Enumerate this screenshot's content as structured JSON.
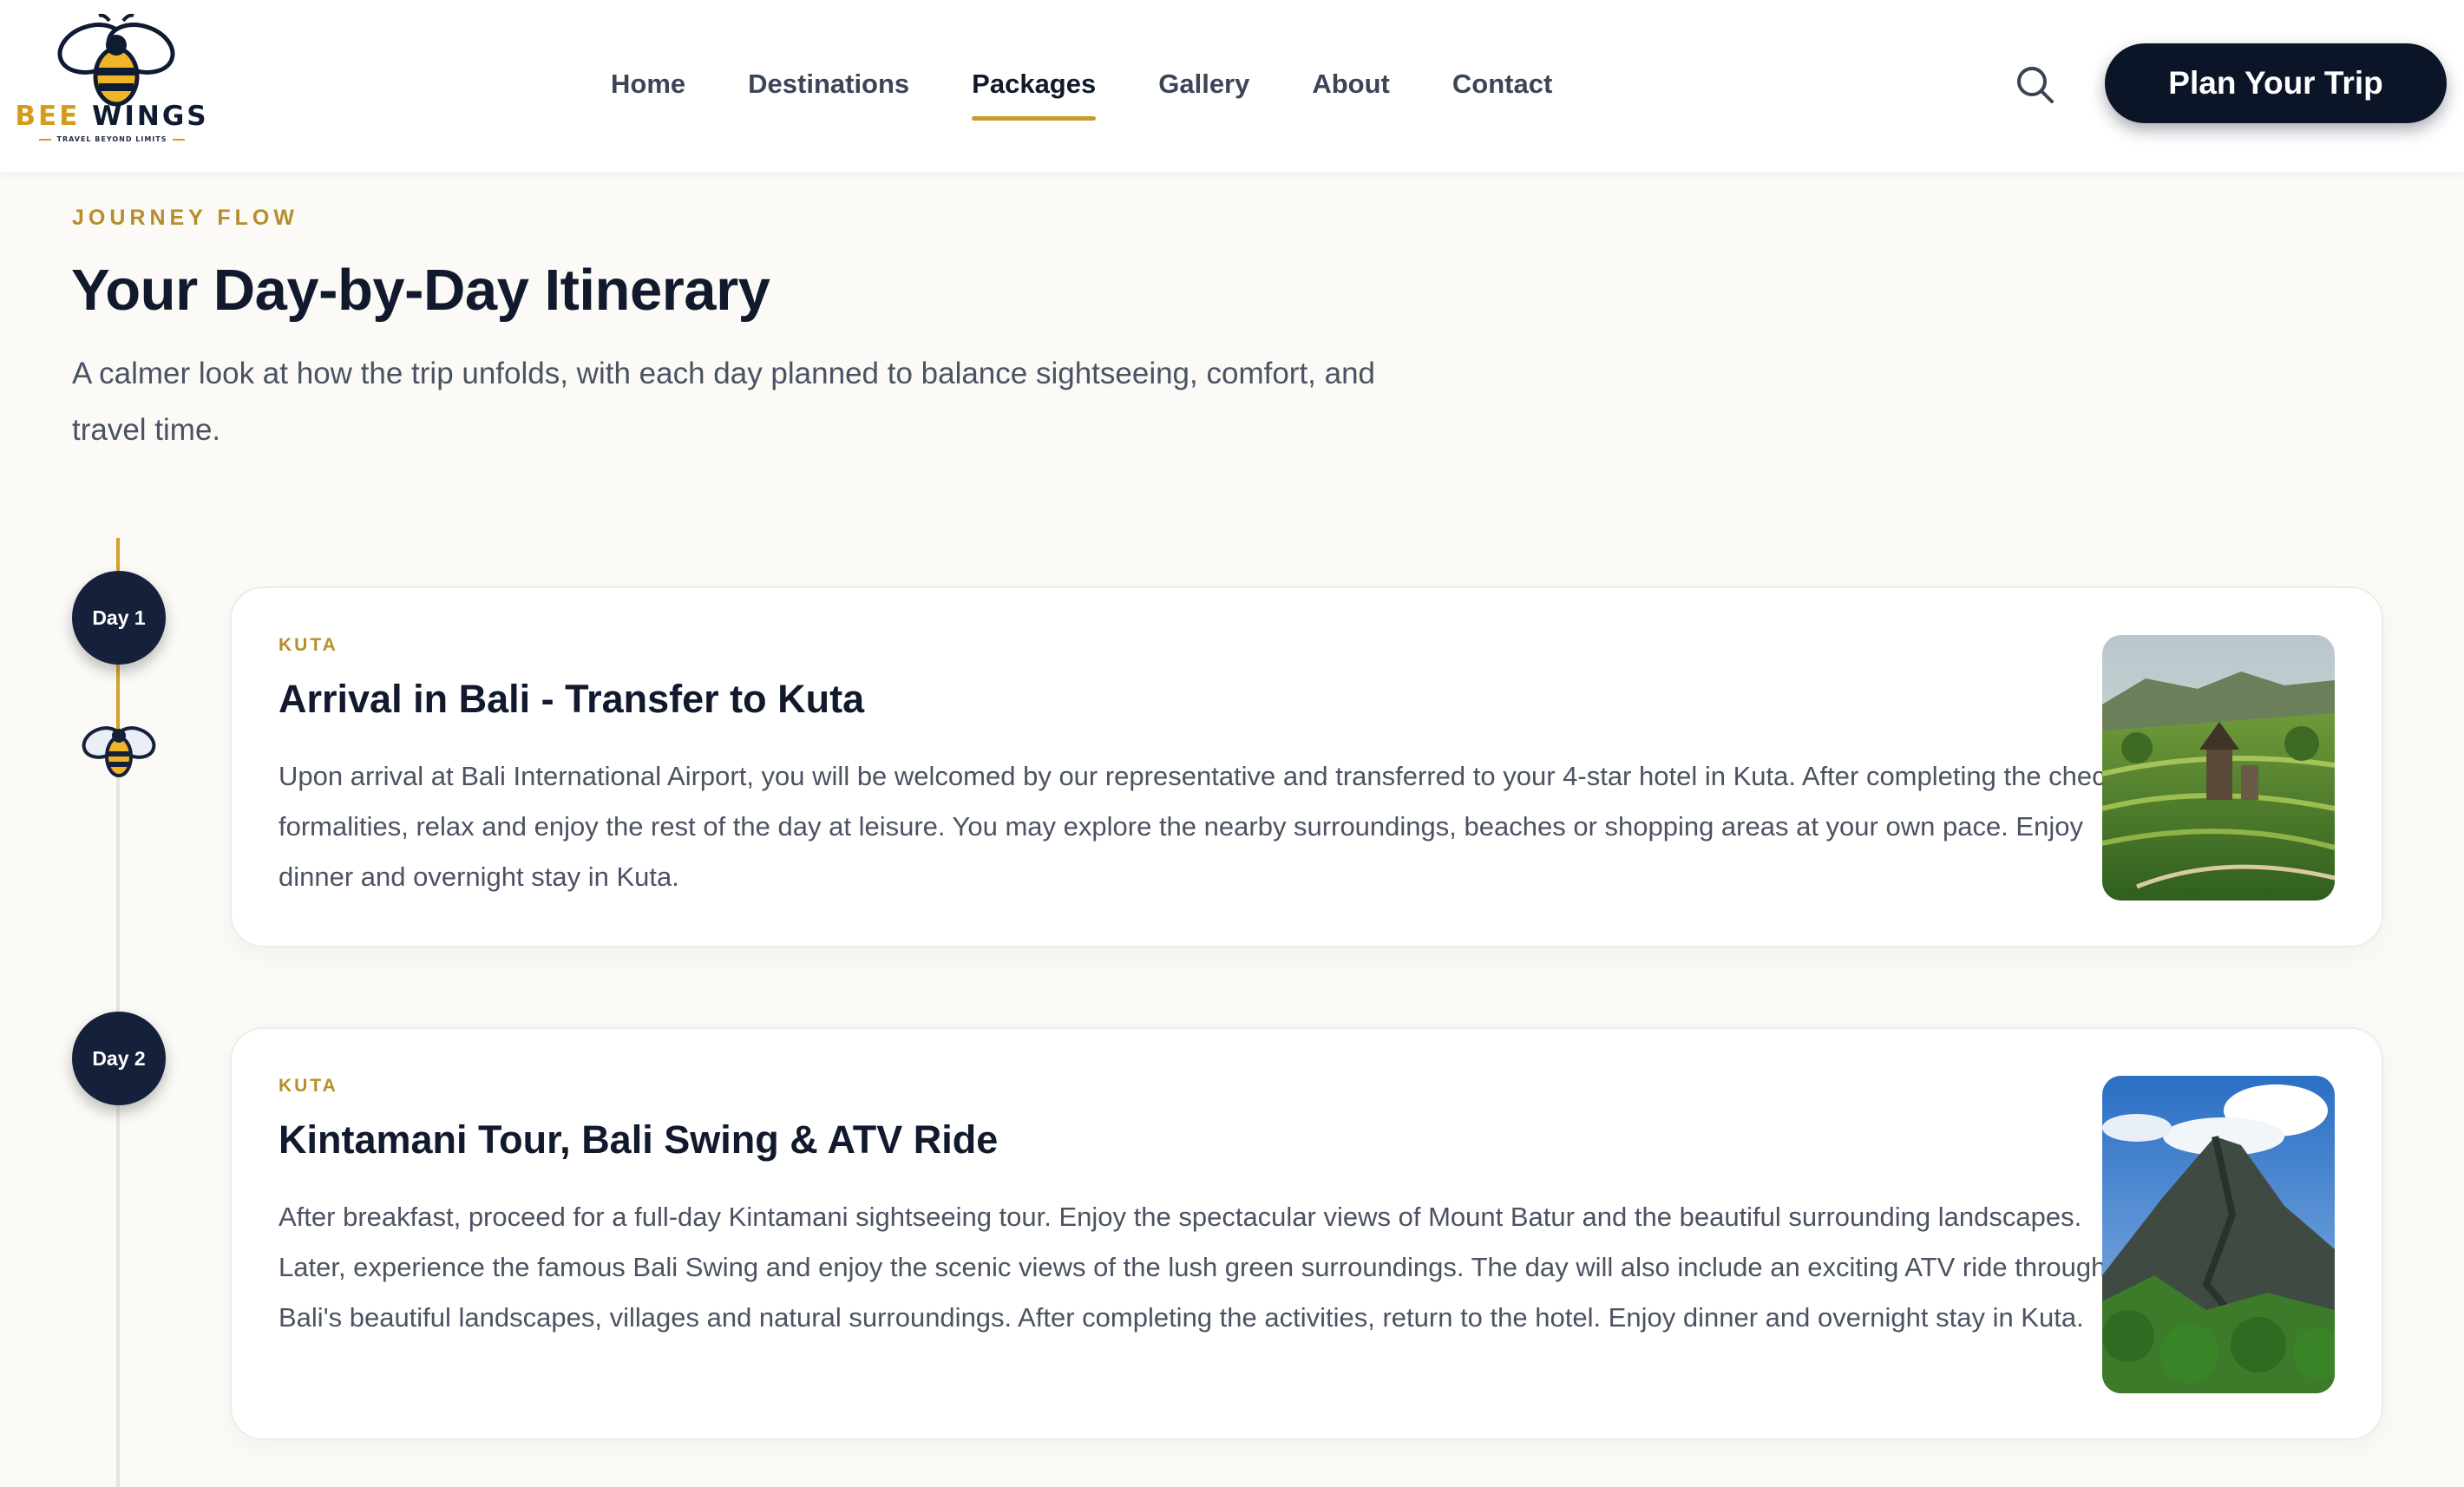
{
  "brand": {
    "name_part1": "BEE",
    "name_part2": "WINGS",
    "tagline": "TRAVEL BEYOND LIMITS"
  },
  "nav": {
    "items": [
      {
        "label": "Home"
      },
      {
        "label": "Destinations"
      },
      {
        "label": "Packages",
        "active": true
      },
      {
        "label": "Gallery"
      },
      {
        "label": "About"
      },
      {
        "label": "Contact"
      }
    ]
  },
  "header": {
    "search_icon": "search-icon",
    "cta_label": "Plan Your Trip"
  },
  "intro": {
    "eyebrow": "JOURNEY FLOW",
    "title": "Your Day-by-Day Itinerary",
    "subtitle": "A calmer look at how the trip unfolds, with each day planned to balance sightseeing, comfort, and travel time."
  },
  "itinerary": [
    {
      "day_label": "Day 1",
      "location": "KUTA",
      "title": "Arrival in Bali - Transfer to Kuta",
      "description": "Upon arrival at Bali International Airport, you will be welcomed by our representative and transferred to your 4-star hotel in Kuta. After completing the check-in formalities, relax and enjoy the rest of the day at leisure. You may explore the nearby surroundings, beaches or shopping areas at your own pace. Enjoy dinner and overnight stay in Kuta.",
      "image": "rice-terrace-temple-photo"
    },
    {
      "day_label": "Day 2",
      "location": "KUTA",
      "title": "Kintamani Tour, Bali Swing & ATV Ride",
      "description": "After breakfast, proceed for a full-day Kintamani sightseeing tour. Enjoy the spectacular views of Mount Batur and the beautiful surrounding landscapes. Later, experience the famous Bali Swing and enjoy the scenic views of the lush green surroundings. The day will also include an exciting ATV ride through Bali's beautiful landscapes, villages and natural surroundings. After completing the activities, return to the hotel. Enjoy dinner and overnight stay in Kuta.",
      "image": "mount-batur-volcano-photo"
    }
  ],
  "colors": {
    "accent_gold": "#c99a2e",
    "navy": "#0c1427",
    "background": "#fbfaf7"
  }
}
